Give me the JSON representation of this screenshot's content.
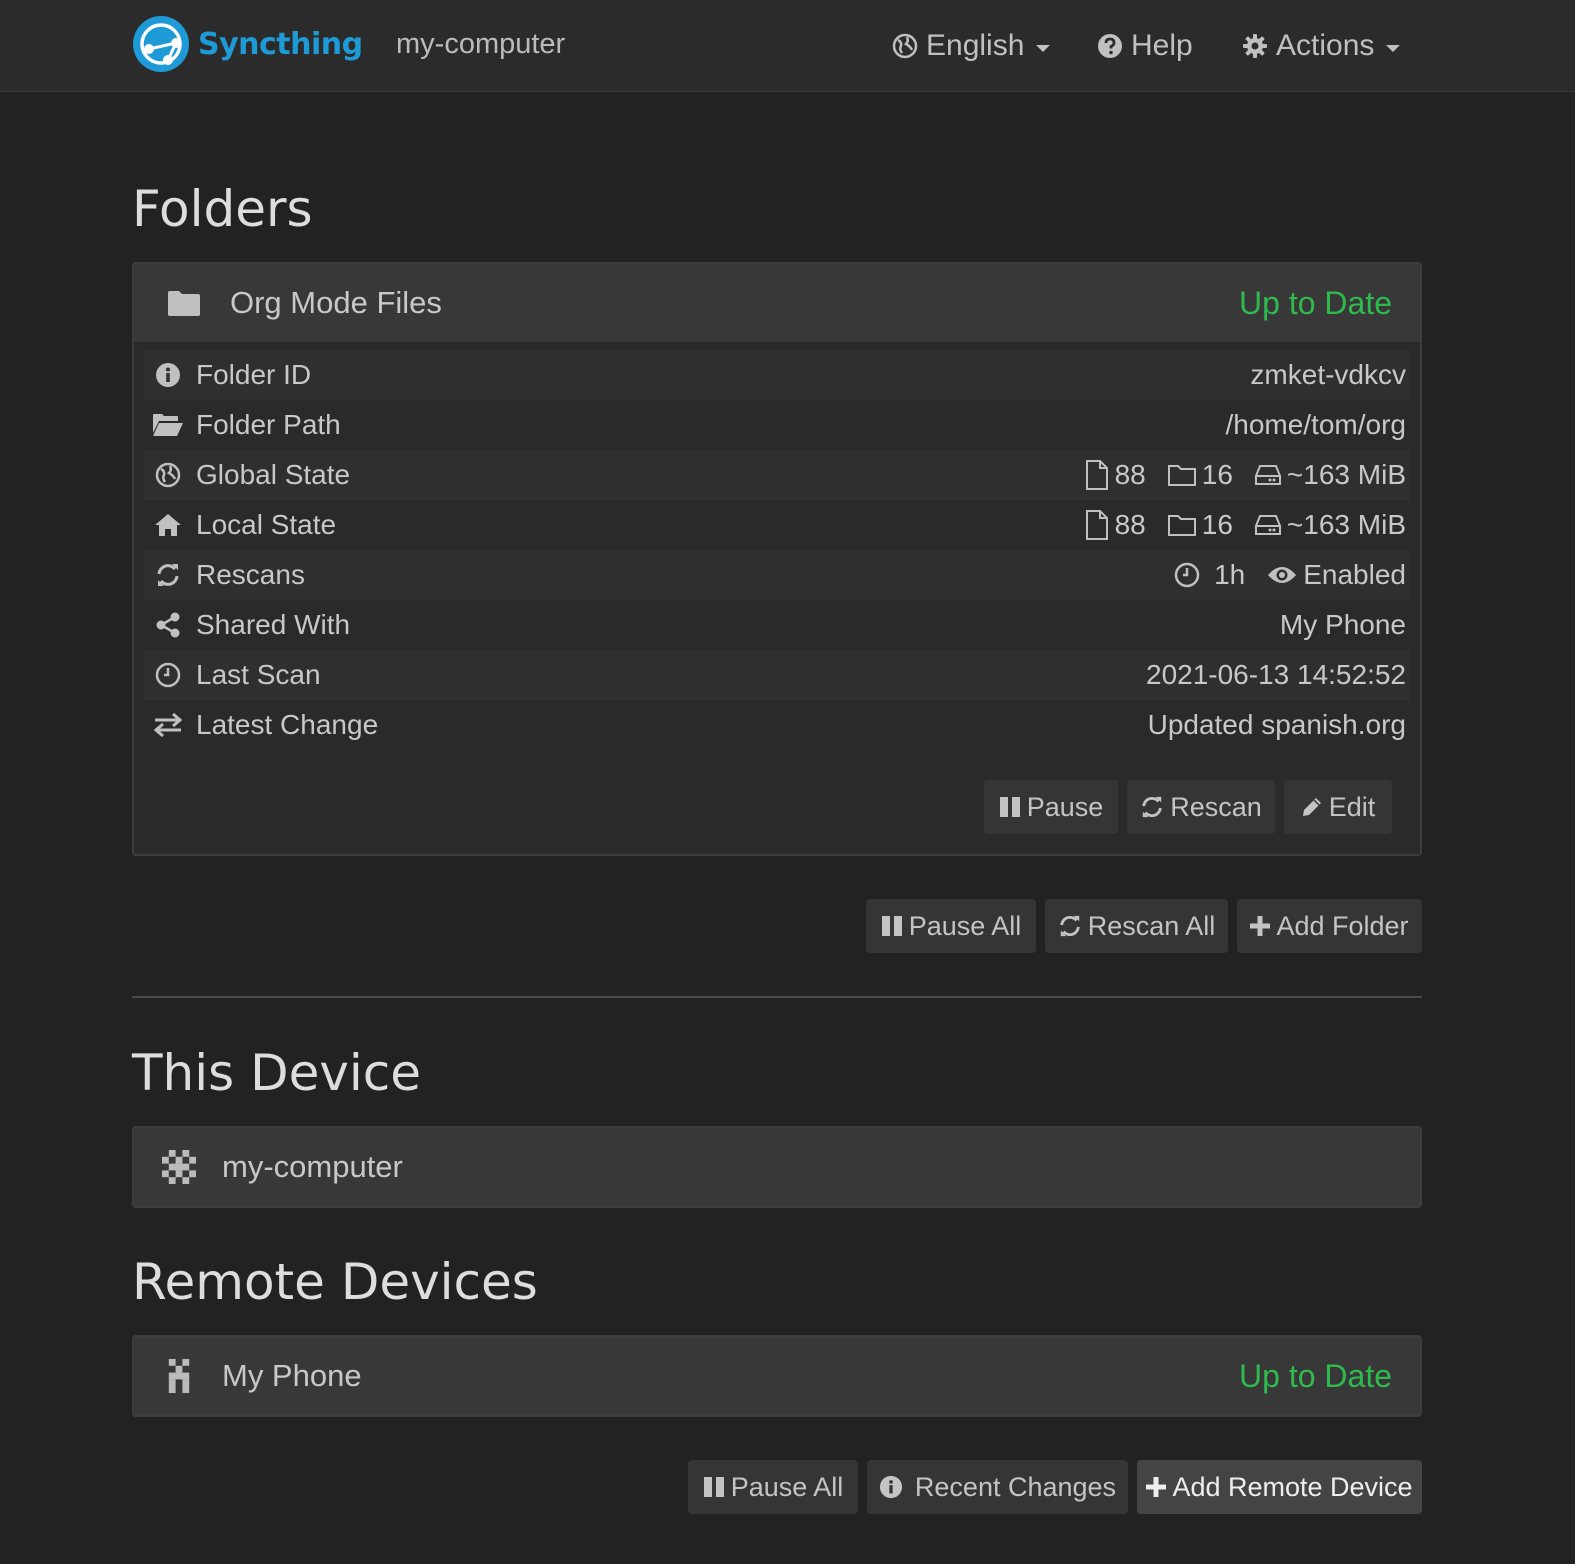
{
  "navbar": {
    "brand": "Syncthing",
    "device_name": "my-computer",
    "language": "English",
    "help": "Help",
    "actions": "Actions"
  },
  "folders": {
    "title": "Folders",
    "items": [
      {
        "name": "Org Mode Files",
        "status": "Up to Date",
        "rows": {
          "folder_id": {
            "label": "Folder ID",
            "value": "zmket-vdkcv"
          },
          "folder_path": {
            "label": "Folder Path",
            "value": "/home/tom/org"
          },
          "global_state": {
            "label": "Global State",
            "files": "88",
            "dirs": "16",
            "size": "~163 MiB"
          },
          "local_state": {
            "label": "Local State",
            "files": "88",
            "dirs": "16",
            "size": "~163 MiB"
          },
          "rescans": {
            "label": "Rescans",
            "interval": "1h",
            "watcher": "Enabled"
          },
          "shared_with": {
            "label": "Shared With",
            "value": "My Phone"
          },
          "last_scan": {
            "label": "Last Scan",
            "value": "2021-06-13 14:52:52"
          },
          "latest_change": {
            "label": "Latest Change",
            "value": "Updated spanish.org"
          }
        },
        "buttons": {
          "pause": "Pause",
          "rescan": "Rescan",
          "edit": "Edit"
        }
      }
    ],
    "buttons": {
      "pause_all": "Pause All",
      "rescan_all": "Rescan All",
      "add_folder": "Add Folder"
    }
  },
  "this_device": {
    "title": "This Device",
    "name": "my-computer"
  },
  "remote_devices": {
    "title": "Remote Devices",
    "items": [
      {
        "name": "My Phone",
        "status": "Up to Date"
      }
    ],
    "buttons": {
      "pause_all": "Pause All",
      "recent_changes": "Recent Changes",
      "add_remote_device": "Add Remote Device"
    }
  },
  "colors": {
    "brand": "#1e9ad6",
    "status_ok": "#2fba4e",
    "background": "#222222",
    "panel_heading": "#383838"
  }
}
